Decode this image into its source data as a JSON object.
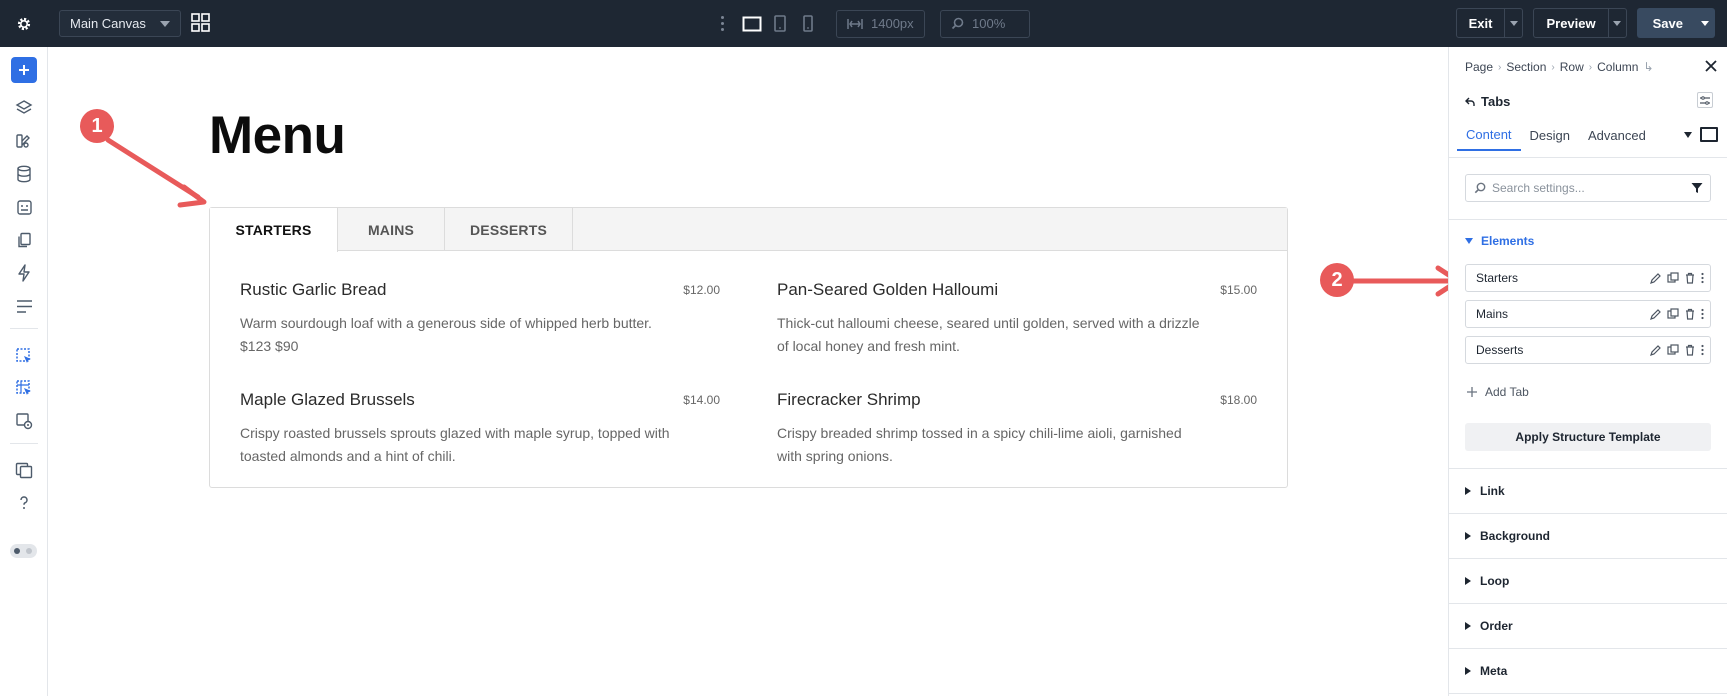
{
  "topbar": {
    "canvas_select": "Main Canvas",
    "width_value": "1400px",
    "zoom_value": "100%",
    "exit_label": "Exit",
    "preview_label": "Preview",
    "save_label": "Save"
  },
  "canvas": {
    "title": "Menu",
    "tabs": [
      {
        "label": "STARTERS"
      },
      {
        "label": "MAINS"
      },
      {
        "label": "DESSERTS"
      }
    ],
    "items": [
      {
        "name": "Rustic Garlic Bread",
        "price": "$12.00",
        "desc": "Warm sourdough loaf with a generous side of whipped herb butter. $123 $90"
      },
      {
        "name": "Pan-Seared Golden Halloumi",
        "price": "$15.00",
        "desc": "Thick-cut halloumi cheese, seared until golden, served with a drizzle of local honey and fresh mint."
      },
      {
        "name": "Maple Glazed Brussels",
        "price": "$14.00",
        "desc": "Crispy roasted brussels sprouts glazed with maple syrup, topped with toasted almonds and a hint of chili."
      },
      {
        "name": "Firecracker Shrimp",
        "price": "$18.00",
        "desc": "Crispy breaded shrimp tossed in a spicy chili-lime aioli, garnished with spring onions."
      }
    ],
    "callouts": [
      "1",
      "2"
    ]
  },
  "panel": {
    "breadcrumb": [
      "Page",
      "Section",
      "Row",
      "Column"
    ],
    "title": "Tabs",
    "tabs": [
      "Content",
      "Design",
      "Advanced"
    ],
    "search_placeholder": "Search settings...",
    "elements_label": "Elements",
    "elements": [
      "Starters",
      "Mains",
      "Desserts"
    ],
    "add_tab_label": "Add Tab",
    "apply_label": "Apply Structure Template",
    "sections": [
      "Link",
      "Background",
      "Loop",
      "Order",
      "Meta"
    ]
  },
  "colors": {
    "topbar_bg": "#1e2733",
    "accent": "#2f6fe4",
    "callout": "#e85a5a"
  }
}
